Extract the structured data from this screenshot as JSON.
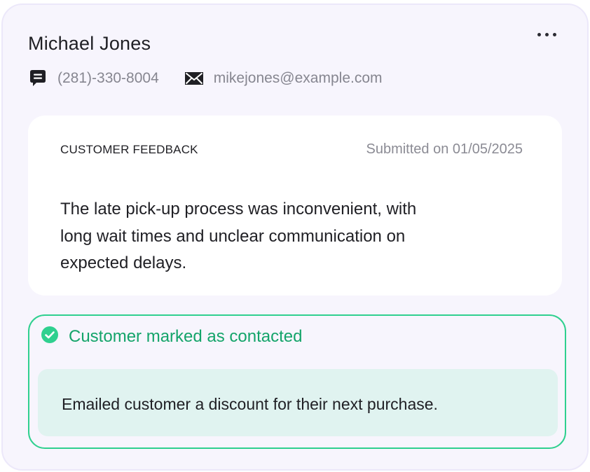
{
  "customer": {
    "name": "Michael Jones",
    "phone": "(281)-330-8004",
    "email": "mikejones@example.com"
  },
  "menu": {
    "icon": "more-horizontal-icon"
  },
  "feedback": {
    "label": "CUSTOMER FEEDBACK",
    "submitted": "Submitted on 01/05/2025",
    "text": "The late pick-up process was inconvenient, with long wait times and unclear communication on expected delays."
  },
  "status": {
    "icon": "check-circle-icon",
    "title": "Customer marked as contacted",
    "note": "Emailed customer a discount for their next purchase.",
    "accent_color": "#2fd08f",
    "text_color": "#14a46a",
    "note_background": "#e0f3f0"
  },
  "icons": {
    "phone": "message-icon",
    "email": "envelope-icon"
  }
}
